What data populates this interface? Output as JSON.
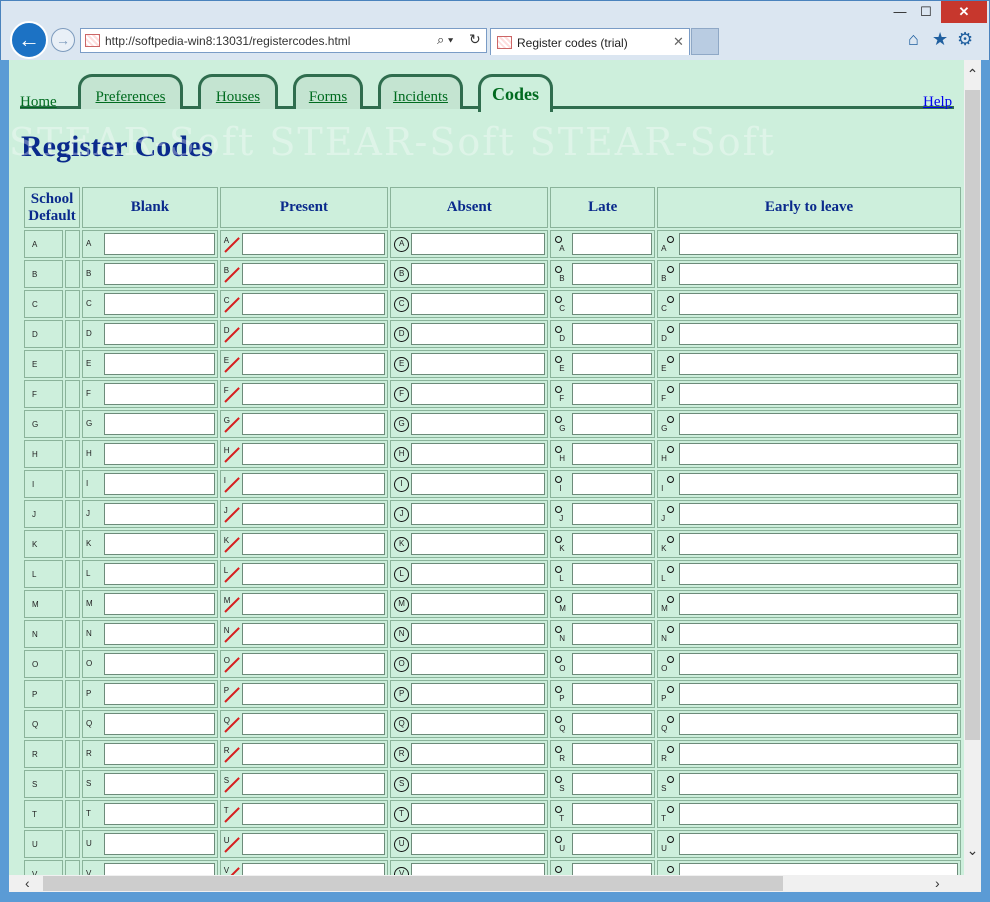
{
  "window": {
    "min": "—",
    "max": "☐",
    "close": "✕"
  },
  "browser": {
    "url": "http://softpedia-win8:13031/registercodes.html",
    "tab_title": "Register codes (trial)",
    "back": "←",
    "forward": "→",
    "search_glyph": "⌕ ▾",
    "refresh_glyph": "↻",
    "tab_close": "✕",
    "home_glyph": "⌂",
    "star_glyph": "★",
    "gear_glyph": "⚙"
  },
  "scroll": {
    "up": "⌃",
    "down": "⌄",
    "left": "‹",
    "right": "›"
  },
  "watermark": "STEAR-Soft    STEAR-Soft    STEAR-Soft",
  "nav": {
    "home": "Home",
    "preferences": "Preferences",
    "houses": "Houses",
    "forms": "Forms",
    "incidents": "Incidents",
    "codes": "Codes",
    "help": "Help"
  },
  "page_title": "Register Codes",
  "table": {
    "headers": {
      "school_default_1": "School",
      "school_default_2": "Default",
      "blank": "Blank",
      "present": "Present",
      "absent": "Absent",
      "late": "Late",
      "early": "Early to leave"
    },
    "letters": [
      "A",
      "B",
      "C",
      "D",
      "E",
      "F",
      "G",
      "H",
      "I",
      "J",
      "K",
      "L",
      "M",
      "N",
      "O",
      "P",
      "Q",
      "R",
      "S",
      "T",
      "U",
      "V"
    ]
  }
}
